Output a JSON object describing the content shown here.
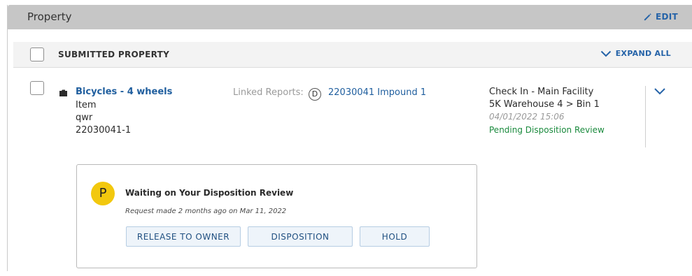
{
  "panel": {
    "title": "Property",
    "edit_label": "EDIT"
  },
  "subheader": {
    "title": "SUBMITTED PROPERTY",
    "expand_all_label": "EXPAND ALL"
  },
  "item": {
    "title": "Bicycles - 4 wheels",
    "type": "Item",
    "description": "qwr",
    "number": "22030041-1",
    "linked_reports_label": "Linked Reports:",
    "linked_badge": "D",
    "linked_report": "22030041 Impound 1",
    "location_line1": "Check In - Main Facility",
    "location_line2": "5K Warehouse 4 > Bin 1",
    "location_date": "04/01/2022 15:06",
    "status": "Pending Disposition Review"
  },
  "review": {
    "avatar_letter": "P",
    "title": "Waiting on Your Disposition Review",
    "subtitle": "Request made 2 months ago on Mar 11, 2022",
    "buttons": [
      "RELEASE TO OWNER",
      "DISPOSITION",
      "HOLD"
    ]
  },
  "colors": {
    "link": "#1f5e9e",
    "status_green": "#1a8a3d",
    "avatar_yellow": "#f2c80e"
  }
}
